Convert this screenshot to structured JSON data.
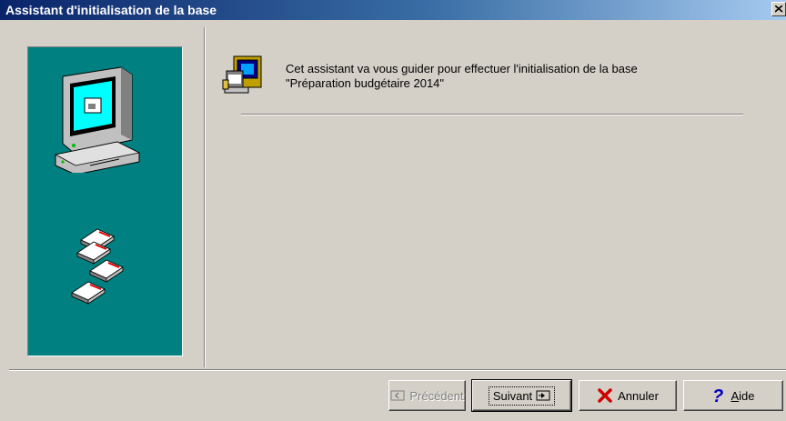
{
  "window": {
    "title": "Assistant d'initialisation de la base"
  },
  "content": {
    "intro_line1": "Cet assistant va vous guider pour effectuer l'initialisation de la base",
    "intro_line2": "\"Préparation budgétaire 2014\""
  },
  "buttons": {
    "previous": {
      "label": "Précédent",
      "enabled": false
    },
    "next": {
      "label": "Suivant",
      "default": true
    },
    "cancel": {
      "label": "Annuler"
    },
    "help": {
      "label_underlined": "A",
      "label_rest": "ide"
    }
  },
  "icons": {
    "close": "close-icon",
    "computer": "computer-icon",
    "floppies": "floppy-disks-icon",
    "wizard": "wizard-icon",
    "previous": "arrow-left-icon",
    "next": "arrow-right-icon",
    "cancel": "red-x-icon",
    "help": "question-mark-icon"
  },
  "colors": {
    "titlebar_start": "#0a246a",
    "titlebar_end": "#a6caf0",
    "side_panel": "#008080",
    "face": "#d4d0c8"
  }
}
